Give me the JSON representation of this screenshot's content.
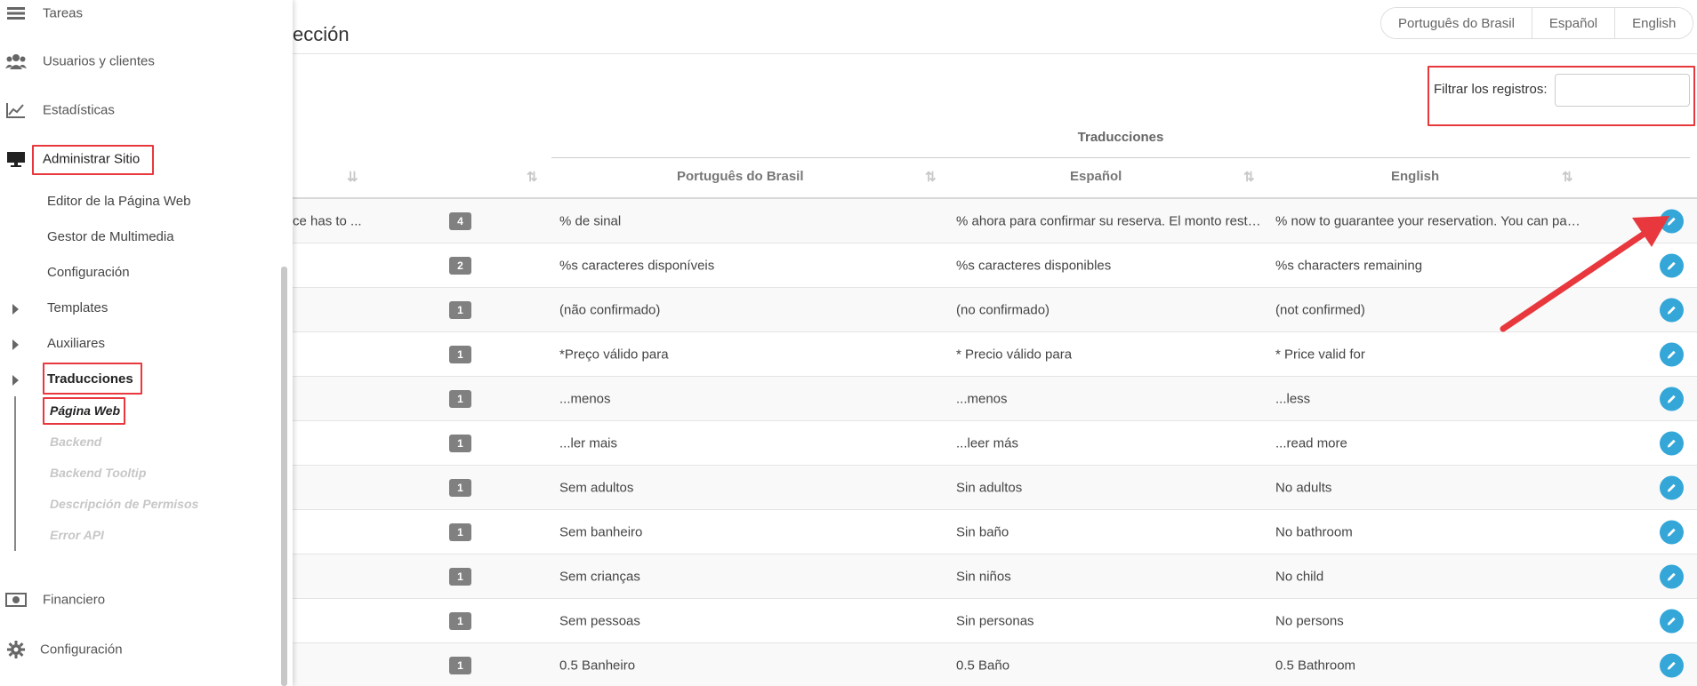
{
  "sidebar": {
    "main_items": [
      {
        "label": "Tareas",
        "icon": "tasks-icon"
      },
      {
        "label": "Usuarios y clientes",
        "icon": "users-icon"
      },
      {
        "label": "Estadísticas",
        "icon": "line-chart-icon"
      },
      {
        "label": "Administrar Sitio",
        "icon": "monitor-icon"
      }
    ],
    "sub_items": [
      "Editor de la Página Web",
      "Gestor de Multimedia",
      "Configuración",
      "Templates",
      "Auxiliares",
      "Traducciones"
    ],
    "translation_leaves": [
      "Página Web",
      "Backend",
      "Backend Tooltip",
      "Descripción de Permisos",
      "Error API"
    ],
    "bottom_items": [
      {
        "label": "Financiero",
        "icon": "money-icon"
      },
      {
        "label": "Configuración",
        "icon": "gear-icon"
      }
    ]
  },
  "page": {
    "title_partial": "ección"
  },
  "languages": [
    "Português do Brasil",
    "Español",
    "English"
  ],
  "filter": {
    "label": "Filtrar los registros:",
    "value": ""
  },
  "table": {
    "group_header": "Traducciones",
    "columns": [
      "Português do Brasil",
      "Español",
      "English"
    ],
    "rows": [
      {
        "key": "ce has to ...",
        "count": "4",
        "pt": "% de sinal",
        "es": "% ahora para confirmar su reserva. El monto restante ...",
        "en": "% now to guarantee your reservation. You can pay ..."
      },
      {
        "key": "",
        "count": "2",
        "pt": "%s caracteres disponíveis",
        "es": "%s caracteres disponibles",
        "en": "%s characters remaining"
      },
      {
        "key": "",
        "count": "1",
        "pt": "(não confirmado)",
        "es": "(no confirmado)",
        "en": "(not confirmed)"
      },
      {
        "key": "",
        "count": "1",
        "pt": "*Preço válido para",
        "es": "* Precio válido para",
        "en": "* Price valid for"
      },
      {
        "key": "",
        "count": "1",
        "pt": "...menos",
        "es": "...menos",
        "en": "...less"
      },
      {
        "key": "",
        "count": "1",
        "pt": "...ler mais",
        "es": "...leer más",
        "en": "...read more"
      },
      {
        "key": "",
        "count": "1",
        "pt": "Sem adultos",
        "es": "Sin adultos",
        "en": "No adults"
      },
      {
        "key": "",
        "count": "1",
        "pt": "Sem banheiro",
        "es": "Sin baño",
        "en": "No bathroom"
      },
      {
        "key": "",
        "count": "1",
        "pt": "Sem crianças",
        "es": "Sin niños",
        "en": "No child"
      },
      {
        "key": "",
        "count": "1",
        "pt": "Sem pessoas",
        "es": "Sin personas",
        "en": "No persons"
      },
      {
        "key": "",
        "count": "1",
        "pt": "0.5 Banheiro",
        "es": "0.5 Baño",
        "en": "0.5 Bathroom"
      }
    ]
  },
  "colors": {
    "accent": "#34a7d8",
    "highlight": "#e8383d",
    "badge": "#808080"
  }
}
